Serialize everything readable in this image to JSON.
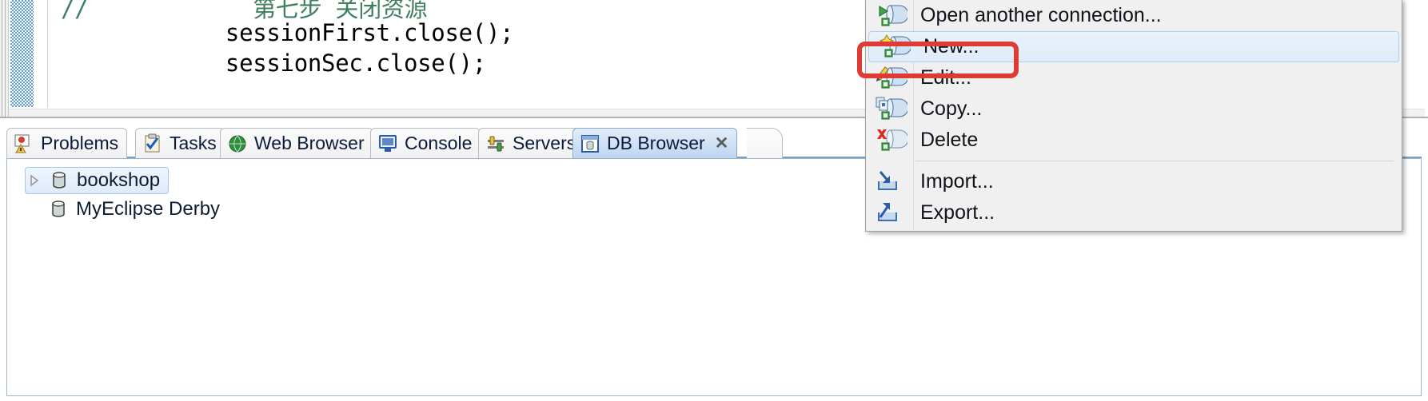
{
  "editor": {
    "code_lines": [
      {
        "text": "//            第七步 关闭资源",
        "kind": "comment"
      },
      {
        "text": "            sessionFirst.close();",
        "kind": "plain"
      },
      {
        "text": "            sessionSec.close();",
        "kind": "plain"
      }
    ],
    "gutter_marker": "change-marker",
    "hscroll_arrow": "scroll-left-arrow"
  },
  "view_tabs": [
    {
      "label": "Problems",
      "icon": "problems-icon",
      "active": false,
      "closable": false
    },
    {
      "label": "Tasks",
      "icon": "tasks-icon",
      "active": false,
      "closable": false
    },
    {
      "label": "Web Browser",
      "icon": "web-browser-icon",
      "active": false,
      "closable": false
    },
    {
      "label": "Console",
      "icon": "console-icon",
      "active": false,
      "closable": false
    },
    {
      "label": "Servers",
      "icon": "servers-icon",
      "active": false,
      "closable": false
    },
    {
      "label": "DB Browser",
      "icon": "db-browser-icon",
      "active": true,
      "closable": true,
      "close_glyph": "✕"
    }
  ],
  "db_tree": {
    "items": [
      {
        "label": "bookshop",
        "icon": "database-icon",
        "expandable": true,
        "expanded": false,
        "selected": true,
        "arrow": "collapsed-arrow"
      },
      {
        "label": "MyEclipse Derby",
        "icon": "database-icon",
        "expandable": false,
        "expanded": false,
        "selected": false
      }
    ]
  },
  "context_menu": {
    "items": [
      {
        "label": "Open another connection...",
        "icon": "open-connection-icon",
        "highlighted": false,
        "separator_after": false
      },
      {
        "label": "New...",
        "icon": "new-connection-icon",
        "highlighted": true,
        "separator_after": false
      },
      {
        "label": "Edit...",
        "icon": "edit-connection-icon",
        "highlighted": false,
        "separator_after": false
      },
      {
        "label": "Copy...",
        "icon": "copy-connection-icon",
        "highlighted": false,
        "separator_after": false
      },
      {
        "label": "Delete",
        "icon": "delete-connection-icon",
        "highlighted": false,
        "separator_after": true
      },
      {
        "label": "Import...",
        "icon": "import-icon",
        "highlighted": false,
        "separator_after": false
      },
      {
        "label": "Export...",
        "icon": "export-icon",
        "highlighted": false,
        "separator_after": false
      }
    ]
  },
  "annotation": {
    "highlight_color": "#e03a35",
    "target_label": "New..."
  },
  "colors": {
    "comment_green": "#3f7f5f",
    "selection_blue": "#dfeafa",
    "tab_active_blue": "#cfe0f4",
    "gutter_marker_blue": "#5c9ae8"
  }
}
